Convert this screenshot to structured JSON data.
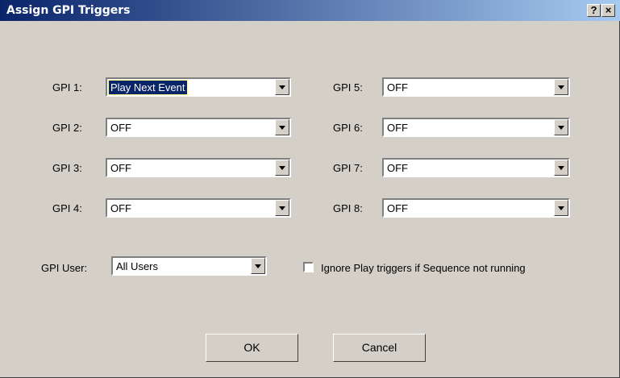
{
  "window": {
    "title": "Assign GPI Triggers",
    "help_button": "?",
    "close_button": "×"
  },
  "gpi_left": [
    {
      "label": "GPI 1:",
      "value": "Play Next Event"
    },
    {
      "label": "GPI 2:",
      "value": "OFF"
    },
    {
      "label": "GPI 3:",
      "value": "OFF"
    },
    {
      "label": "GPI 4:",
      "value": "OFF"
    }
  ],
  "gpi_right": [
    {
      "label": "GPI 5:",
      "value": "OFF"
    },
    {
      "label": "GPI 6:",
      "value": "OFF"
    },
    {
      "label": "GPI 7:",
      "value": "OFF"
    },
    {
      "label": "GPI 8:",
      "value": "OFF"
    }
  ],
  "user": {
    "label": "GPI User:",
    "value": "All Users"
  },
  "ignore_checkbox": {
    "label": "Ignore Play triggers if Sequence not running",
    "checked": false
  },
  "buttons": {
    "ok": "OK",
    "cancel": "Cancel"
  }
}
